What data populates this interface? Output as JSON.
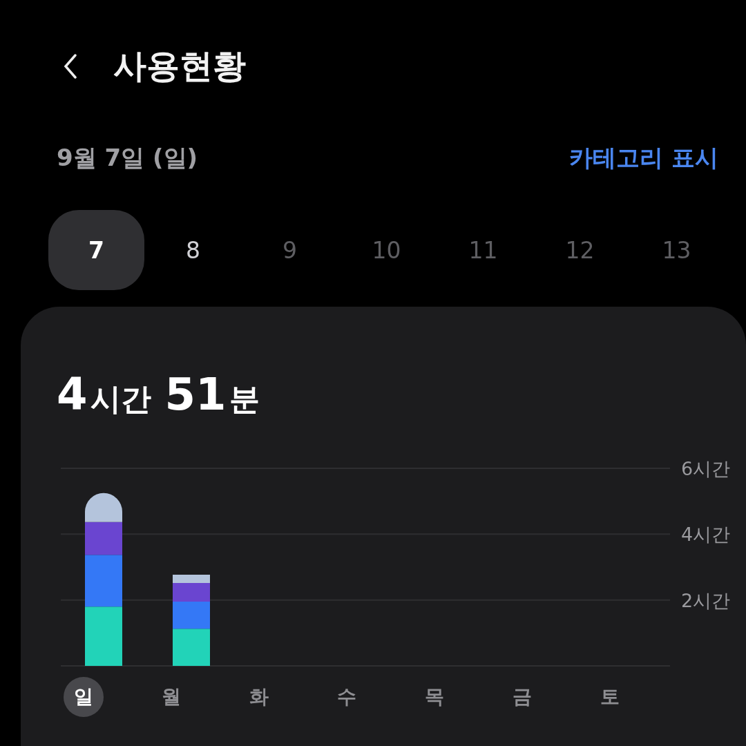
{
  "header": {
    "title": "사용현황"
  },
  "date_label": "9월 7일 (일)",
  "category_link": "카테고리 표시",
  "days": [
    {
      "label": "7",
      "selected": true,
      "disabled": false
    },
    {
      "label": "8",
      "selected": false,
      "disabled": false
    },
    {
      "label": "9",
      "selected": false,
      "disabled": true
    },
    {
      "label": "10",
      "selected": false,
      "disabled": true
    },
    {
      "label": "11",
      "selected": false,
      "disabled": true
    },
    {
      "label": "12",
      "selected": false,
      "disabled": true
    },
    {
      "label": "13",
      "selected": false,
      "disabled": true
    }
  ],
  "total": {
    "hours": "4",
    "hours_unit": "시간",
    "minutes": "51",
    "minutes_unit": "분"
  },
  "chart_data": {
    "type": "bar",
    "stacked": true,
    "categories": [
      "일",
      "월",
      "화",
      "수",
      "목",
      "금",
      "토"
    ],
    "ylim": [
      0,
      6
    ],
    "yticks": [
      {
        "value": 2,
        "label": "2시간"
      },
      {
        "value": 4,
        "label": "4시간"
      },
      {
        "value": 6,
        "label": "6시간"
      }
    ],
    "series": [
      {
        "color": "#22d3b8",
        "values": [
          1.8,
          1.13,
          null,
          null,
          null,
          null,
          null
        ]
      },
      {
        "color": "#3478f6",
        "values": [
          1.57,
          0.82,
          null,
          null,
          null,
          null,
          null
        ]
      },
      {
        "color": "#6a45d0",
        "values": [
          1.0,
          0.57,
          null,
          null,
          null,
          null,
          null
        ]
      },
      {
        "color": "#b4c4dc",
        "values": [
          0.88,
          0.25,
          null,
          null,
          null,
          null,
          null
        ]
      }
    ]
  },
  "weekday_selected": [
    true,
    false,
    false,
    false,
    false,
    false,
    false
  ]
}
